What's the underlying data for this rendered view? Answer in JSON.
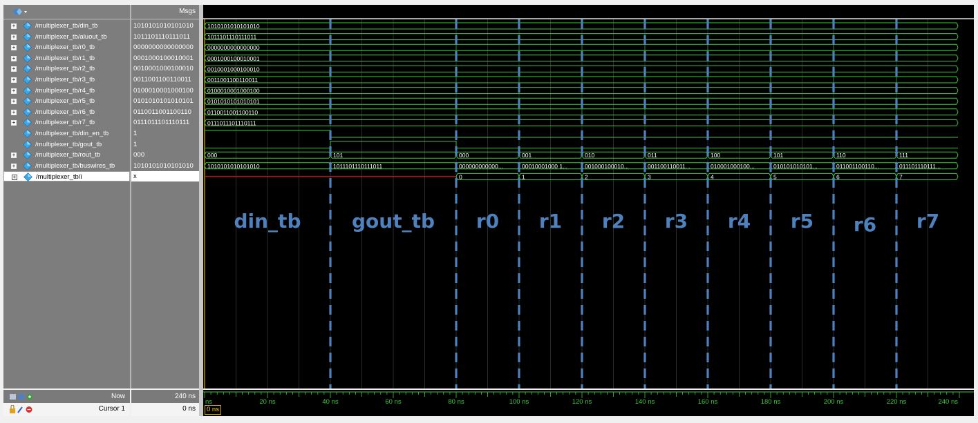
{
  "toolbar": {
    "msgs_header": "Msgs",
    "menu_icon": "wave-menu-icon"
  },
  "signals": [
    {
      "name": "/multiplexer_tb/din_tb",
      "value": "1010101010101010",
      "icon": "diamond-icon",
      "expandable": true
    },
    {
      "name": "/multiplexer_tb/aluout_tb",
      "value": "1011101110111011",
      "icon": "diamond-icon",
      "expandable": true
    },
    {
      "name": "/multiplexer_tb/r0_tb",
      "value": "0000000000000000",
      "icon": "diamond-icon",
      "expandable": true
    },
    {
      "name": "/multiplexer_tb/r1_tb",
      "value": "0001000100010001",
      "icon": "diamond-icon",
      "expandable": true
    },
    {
      "name": "/multiplexer_tb/r2_tb",
      "value": "0010001000100010",
      "icon": "diamond-icon",
      "expandable": true
    },
    {
      "name": "/multiplexer_tb/r3_tb",
      "value": "0011001100110011",
      "icon": "diamond-icon",
      "expandable": true
    },
    {
      "name": "/multiplexer_tb/r4_tb",
      "value": "0100010001000100",
      "icon": "diamond-icon",
      "expandable": true
    },
    {
      "name": "/multiplexer_tb/r5_tb",
      "value": "0101010101010101",
      "icon": "diamond-icon",
      "expandable": true
    },
    {
      "name": "/multiplexer_tb/r6_tb",
      "value": "0110011001100110",
      "icon": "diamond-icon",
      "expandable": true
    },
    {
      "name": "/multiplexer_tb/r7_tb",
      "value": "0111011101110111",
      "icon": "diamond-icon",
      "expandable": true
    },
    {
      "name": "/multiplexer_tb/din_en_tb",
      "value": "1",
      "icon": "diamond-icon",
      "expandable": false
    },
    {
      "name": "/multiplexer_tb/gout_tb",
      "value": "1",
      "icon": "diamond-icon",
      "expandable": false
    },
    {
      "name": "/multiplexer_tb/rout_tb",
      "value": "000",
      "icon": "diamond-icon",
      "expandable": true
    },
    {
      "name": "/multiplexer_tb/buswires_tb",
      "value": "1010101010101010",
      "icon": "diamond-icon",
      "expandable": true
    },
    {
      "name": "/multiplexer_tb/i",
      "value": "x",
      "icon": "diamond-icon",
      "expandable": true,
      "selected": true
    }
  ],
  "waves": {
    "bus_constant": [
      "1010101010101010",
      "1011101110111011",
      "0000000000000000",
      "0001000100010001",
      "0010001000100010",
      "0011001100110011",
      "0100010001000100",
      "0101010101010101",
      "0110011001100110",
      "0111011101110111"
    ],
    "din_en_tb": [
      {
        "t": 0,
        "v": 1
      },
      {
        "t": 40,
        "v": 0
      }
    ],
    "gout_tb": [
      {
        "t": 0,
        "v": 0
      },
      {
        "t": 40,
        "v": 1
      },
      {
        "t": 80,
        "v": 0
      }
    ],
    "rout_tb": [
      {
        "t": 0,
        "label": "000"
      },
      {
        "t": 40,
        "label": "101"
      },
      {
        "t": 80,
        "label": "000"
      },
      {
        "t": 100,
        "label": "001"
      },
      {
        "t": 120,
        "label": "010"
      },
      {
        "t": 140,
        "label": "011"
      },
      {
        "t": 160,
        "label": "100"
      },
      {
        "t": 180,
        "label": "101"
      },
      {
        "t": 200,
        "label": "110"
      },
      {
        "t": 220,
        "label": "111"
      }
    ],
    "buswires_tb": [
      {
        "t": 0,
        "label": "1010101010101010"
      },
      {
        "t": 40,
        "label": "1011101110111011"
      },
      {
        "t": 80,
        "label": "000000000000..."
      },
      {
        "t": 100,
        "label": "00010001000 1..."
      },
      {
        "t": 120,
        "label": "001000100010..."
      },
      {
        "t": 140,
        "label": "001100110011..."
      },
      {
        "t": 160,
        "label": "010001000100..."
      },
      {
        "t": 180,
        "label": "010101010101..."
      },
      {
        "t": 200,
        "label": "011001100110..."
      },
      {
        "t": 220,
        "label": "011101110111..."
      }
    ],
    "i": [
      {
        "t": 80,
        "label": "0"
      },
      {
        "t": 100,
        "label": "1"
      },
      {
        "t": 120,
        "label": "2"
      },
      {
        "t": 140,
        "label": "3"
      },
      {
        "t": 160,
        "label": "4"
      },
      {
        "t": 180,
        "label": "5"
      },
      {
        "t": 200,
        "label": "6"
      },
      {
        "t": 220,
        "label": "7"
      }
    ],
    "i_undefined_until": 80,
    "time_end": 240
  },
  "markers": [
    0,
    40,
    80,
    100,
    120,
    140,
    160,
    180,
    200,
    220
  ],
  "annotations": [
    {
      "text": "din_tb",
      "t": 20
    },
    {
      "text": "gout_tb",
      "t": 60
    },
    {
      "text": "r0",
      "t": 90
    },
    {
      "text": "r1",
      "t": 110
    },
    {
      "text": "r2",
      "t": 130
    },
    {
      "text": "r3",
      "t": 150
    },
    {
      "text": "r4",
      "t": 170
    },
    {
      "text": "r5",
      "t": 190
    },
    {
      "text": "r6",
      "t": 210
    },
    {
      "text": "r7",
      "t": 230
    }
  ],
  "timeline": {
    "ticks": [
      "ns",
      "20 ns",
      "40 ns",
      "60 ns",
      "80 ns",
      "100 ns",
      "120 ns",
      "140 ns",
      "160 ns",
      "180 ns",
      "200 ns",
      "220 ns",
      "240 ns"
    ],
    "tick_values": [
      0,
      20,
      40,
      60,
      80,
      100,
      120,
      140,
      160,
      180,
      200,
      220,
      240
    ]
  },
  "status": {
    "now_label": "Now",
    "now_value": "240 ns",
    "cursor_label": "Cursor 1",
    "cursor_value": "0 ns",
    "cursor_box": "0 ns"
  },
  "colors": {
    "wave_green": "#3cc83c",
    "wave_red": "#d42020",
    "marker_blue": "#4f81bd",
    "annotation_blue": "#4f81bd",
    "cursor_yellow": "#ffd200",
    "grid": "#4a4a4a"
  }
}
